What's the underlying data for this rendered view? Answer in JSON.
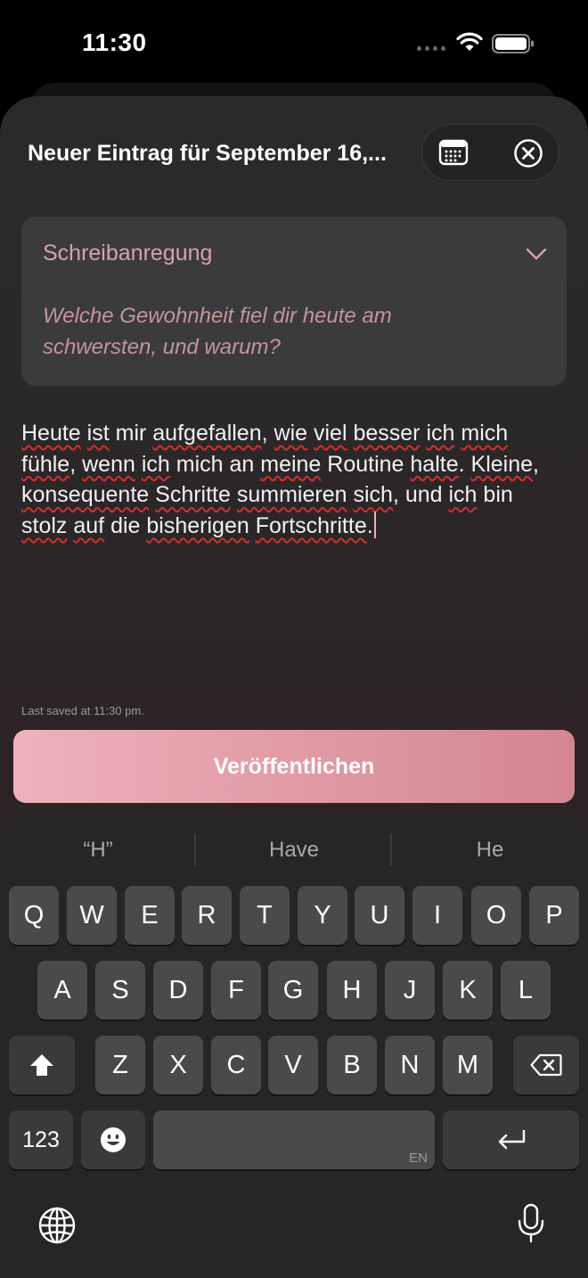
{
  "status_bar": {
    "time": "11:30"
  },
  "header": {
    "title": "Neuer Eintrag für September 16,..."
  },
  "prompt": {
    "heading": "Schreibanregung",
    "question": "Welche Gewohnheit fiel dir heute am schwersten, und warum?"
  },
  "entry": {
    "words": {
      "w1": "Heute",
      "w2": "ist",
      "w3": " mir ",
      "w4": "aufgefallen",
      "w5": ", ",
      "w6": "wie",
      "w7": " ",
      "w8": "viel",
      "w9": " ",
      "w10": "besser",
      "w11": " ",
      "w12": "ich",
      "w13": " ",
      "w14": "mich",
      "w15": "fühle",
      "w16": ", ",
      "w17": "wenn",
      "w18": " ",
      "w19": "ich",
      "w20": " mich an ",
      "w21": "meine",
      "w22": " Routine ",
      "w23": "halte",
      "w24": ". ",
      "w25": "Kleine",
      "w26": ",",
      "w27": "konsequente",
      "w28": " ",
      "w29": "Schritte",
      "w30": " ",
      "w31": "summieren",
      "w32": " ",
      "w33": "sich",
      "w34": ", und ",
      "w35": "ich",
      "w36": " bin",
      "w37": "stolz",
      "w38": " ",
      "w39": "auf",
      "w40": " die ",
      "w41": "bisherigen",
      "w42": " ",
      "w43": "Fortschritte",
      "w44": "."
    }
  },
  "last_saved": "Last saved at 11:30 pm.",
  "publish_label": "Veröffentlichen",
  "keyboard": {
    "suggestions": [
      "“H”",
      "Have",
      "He"
    ],
    "row1": [
      "Q",
      "W",
      "E",
      "R",
      "T",
      "Y",
      "U",
      "I",
      "O",
      "P"
    ],
    "row2": [
      "A",
      "S",
      "D",
      "F",
      "G",
      "H",
      "J",
      "K",
      "L"
    ],
    "row3": [
      "Z",
      "X",
      "C",
      "V",
      "B",
      "N",
      "M"
    ],
    "numbers_label": "123",
    "space_lang": "EN"
  },
  "colors": {
    "accent": "#d7a2a8",
    "publish_start": "#efb1bb",
    "publish_end": "#d3868f"
  }
}
